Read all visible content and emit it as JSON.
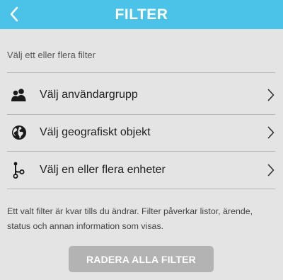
{
  "header": {
    "title": "FILTER",
    "back_icon": "chevron-left-icon",
    "background_color": "#4bc3e8"
  },
  "intro": "Välj ett eller flera filter",
  "filters": [
    {
      "label": "Välj användargrupp",
      "icon": "user-group-icon"
    },
    {
      "label": "Välj geografiskt objekt",
      "icon": "globe-icon"
    },
    {
      "label": "Välj en eller flera enheter",
      "icon": "hierarchy-icon"
    }
  ],
  "info_text": "Ett valt filter är kvar tills du ändrar. Filter påverkar listor, ärende, status och annan information som visas.",
  "clear_button": {
    "label": "RADERA ALLA FILTER",
    "color": "#b3b3b3"
  }
}
